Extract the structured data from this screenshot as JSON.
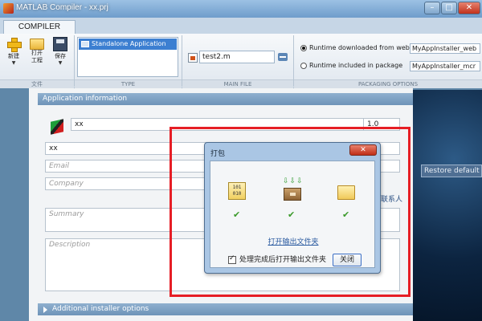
{
  "window": {
    "title": "MATLAB Compiler - xx.prj",
    "minimize_glyph": "–",
    "maximize_glyph": "□",
    "close_glyph": "✕"
  },
  "ribbon": {
    "tab_label": "COMPILER",
    "file_group": {
      "caption": "文件",
      "new_label": "新建",
      "open_label_1": "打开",
      "open_label_2": "工程",
      "save_label": "保存",
      "caret": "▼"
    },
    "type_group": {
      "caption": "TYPE",
      "selected_type": "Standalone Application"
    },
    "main_file_group": {
      "caption": "MAIN FILE",
      "file_name": "test2.m"
    },
    "packaging_group": {
      "caption": "PACKAGING OPTIONS",
      "option_web_label": "Runtime downloaded from web",
      "option_web_value": "MyAppInstaller_web",
      "option_package_label": "Runtime included in package",
      "option_package_value": "MyAppInstaller_mcr",
      "selected": "web"
    }
  },
  "app_info": {
    "header": "Application information",
    "name_value": "xx",
    "version_value": "1.0",
    "author_value": "xx",
    "email_placeholder": "Email",
    "company_placeholder": "Company",
    "contact_link": "联系人",
    "summary_placeholder": "Summary",
    "description_placeholder": "Description"
  },
  "preview": {
    "restore_button": "Restore default splash"
  },
  "additional": {
    "header": "Additional installer options"
  },
  "dialog": {
    "title": "打包",
    "close_glyph": "✕",
    "binary_glyph": "101\n010",
    "arrows_glyph": "⇩⇩⇩",
    "check_glyph": "✔",
    "open_folder_link": "打开输出文件夹",
    "auto_open_label": "处理完成后打开输出文件夹",
    "auto_open_checked": true,
    "close_button": "关闭"
  },
  "colors": {
    "highlight": "#e61e25",
    "ribbon_selection": "#3c7fd1"
  }
}
